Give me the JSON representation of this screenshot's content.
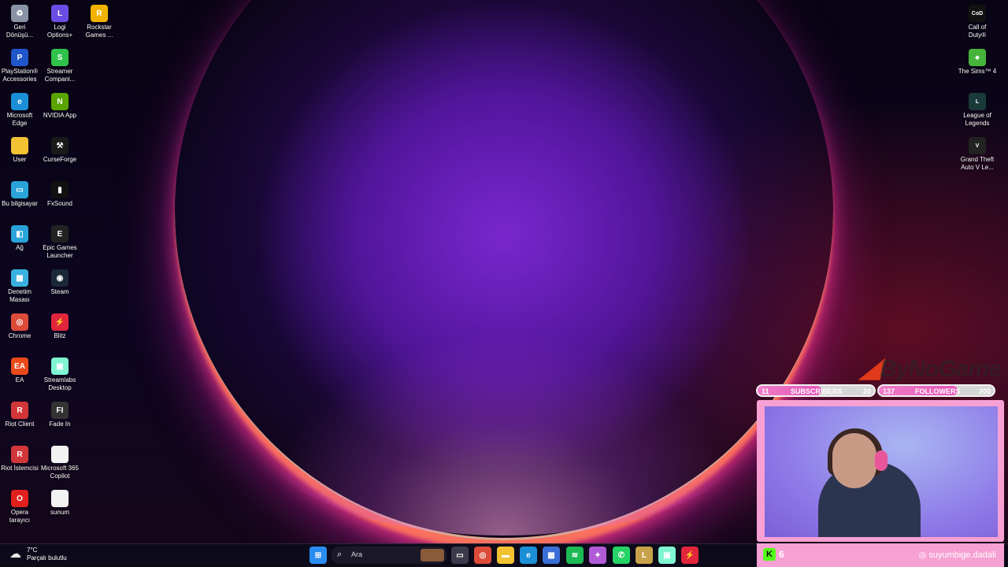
{
  "desktop": {
    "left_icons": [
      {
        "label": "Geri\nDönüşü...",
        "icon": "recycle-bin-icon",
        "color": "#8a93a6",
        "glyph": "♻"
      },
      {
        "label": "Logi\nOptions+",
        "icon": "logi-options-icon",
        "color": "#6b4de6",
        "glyph": "L"
      },
      {
        "label": "Rockstar\nGames ...",
        "icon": "rockstar-icon",
        "color": "#f2b300",
        "glyph": "R"
      },
      {
        "label": "PlayStation®\nAccessories",
        "icon": "playstation-icon",
        "color": "#1f56c9",
        "glyph": "P"
      },
      {
        "label": "Streamer\nCompani...",
        "icon": "streamer-companion-icon",
        "color": "#30c24a",
        "glyph": "S"
      },
      {
        "label": "Microsoft\nEdge",
        "icon": "edge-icon",
        "color": "#1b8fd6",
        "glyph": "e"
      },
      {
        "label": "NVIDIA App",
        "icon": "nvidia-icon",
        "color": "#5aa400",
        "glyph": "N"
      },
      {
        "label": "User",
        "icon": "folder-icon",
        "color": "#f3c233",
        "glyph": ""
      },
      {
        "label": "CurseForge",
        "icon": "curseforge-icon",
        "color": "#1a1a1a",
        "glyph": "⚒"
      },
      {
        "label": "Bu bilgisayar",
        "icon": "computer-icon",
        "color": "#2aa3d8",
        "glyph": "▭"
      },
      {
        "label": "FxSound",
        "icon": "fxsound-icon",
        "color": "#111111",
        "glyph": "▮"
      },
      {
        "label": "Ağ",
        "icon": "network-icon",
        "color": "#2aa3d8",
        "glyph": "◧"
      },
      {
        "label": "Epic Games\nLauncher",
        "icon": "epic-games-icon",
        "color": "#222222",
        "glyph": "E"
      },
      {
        "label": "Denetim\nMasası",
        "icon": "control-panel-icon",
        "color": "#3ab0e0",
        "glyph": "▦"
      },
      {
        "label": "Steam",
        "icon": "steam-icon",
        "color": "#1b2838",
        "glyph": "◉"
      },
      {
        "label": "Chrome",
        "icon": "chrome-icon",
        "color": "#dd4b39",
        "glyph": "◎"
      },
      {
        "label": "Blitz",
        "icon": "blitz-icon",
        "color": "#e0253c",
        "glyph": "⚡"
      },
      {
        "label": "EA",
        "icon": "ea-icon",
        "color": "#ea4a1a",
        "glyph": "EA"
      },
      {
        "label": "Streamlabs\nDesktop",
        "icon": "streamlabs-icon",
        "color": "#80f5d2",
        "glyph": "▣"
      },
      {
        "label": "Riot Client",
        "icon": "riot-client-icon",
        "color": "#d13639",
        "glyph": "R"
      },
      {
        "label": "Fade In",
        "icon": "fade-in-icon",
        "color": "#333333",
        "glyph": "FI"
      },
      {
        "label": "Riot İstemcisi",
        "icon": "riot-istemcisi-icon",
        "color": "#d13639",
        "glyph": "R"
      },
      {
        "label": "Microsoft 365\nCopilot",
        "icon": "document-icon",
        "color": "#f2f2f2",
        "glyph": ""
      },
      {
        "label": "Opera\ntarayıcı",
        "icon": "opera-icon",
        "color": "#e0201d",
        "glyph": "O"
      },
      {
        "label": "sunum",
        "icon": "document-icon",
        "color": "#f2f2f2",
        "glyph": ""
      }
    ],
    "right_icons": [
      {
        "label": "Call of\nDuty®",
        "icon": "call-of-duty-icon",
        "color": "#111111",
        "glyph": "CoD"
      },
      {
        "label": "The Sims™ 4",
        "icon": "sims-icon",
        "color": "#46b43a",
        "glyph": "◆"
      },
      {
        "label": "League of\nLegends",
        "icon": "league-of-legends-icon",
        "color": "#1a3a3a",
        "glyph": "L"
      },
      {
        "label": "Grand Theft\nAuto V Le...",
        "icon": "gta-icon",
        "color": "#222222",
        "glyph": "V"
      }
    ]
  },
  "overlay": {
    "logo_text": "ByNoGame",
    "subscribers": {
      "current": "11",
      "label": "SUBSCRIBERS",
      "goal": "20",
      "progress": 0.55
    },
    "followers": {
      "current": "137",
      "label": "FOLLOWERS",
      "goal": "200",
      "progress": 0.685
    },
    "kick_count": "6",
    "instagram": "suyumbige.dadali"
  },
  "taskbar": {
    "weather_temp": "7°C",
    "weather_desc": "Parçalı bulutlu",
    "search_placeholder": "Ara",
    "apps": [
      {
        "name": "start-icon",
        "color": "#2a8cf0",
        "glyph": "⊞"
      },
      {
        "name": "task-view-icon",
        "color": "#3a3a4a",
        "glyph": "▭"
      },
      {
        "name": "chrome-icon",
        "color": "#dd4b39",
        "glyph": "◎"
      },
      {
        "name": "file-explorer-icon",
        "color": "#f3c233",
        "glyph": "▬"
      },
      {
        "name": "edge-icon",
        "color": "#1b8fd6",
        "glyph": "e"
      },
      {
        "name": "microsoft-store-icon",
        "color": "#3a6fd8",
        "glyph": "▦"
      },
      {
        "name": "spotify-icon",
        "color": "#1db954",
        "glyph": "≋"
      },
      {
        "name": "copilot-icon",
        "color": "#b05ad8",
        "glyph": "✦"
      },
      {
        "name": "whatsapp-icon",
        "color": "#25d366",
        "glyph": "✆"
      },
      {
        "name": "league-client-icon",
        "color": "#c8a24a",
        "glyph": "L"
      },
      {
        "name": "streamlabs-icon",
        "color": "#80f5d2",
        "glyph": "▣"
      },
      {
        "name": "blitz-icon",
        "color": "#e0253c",
        "glyph": "⚡"
      }
    ]
  }
}
